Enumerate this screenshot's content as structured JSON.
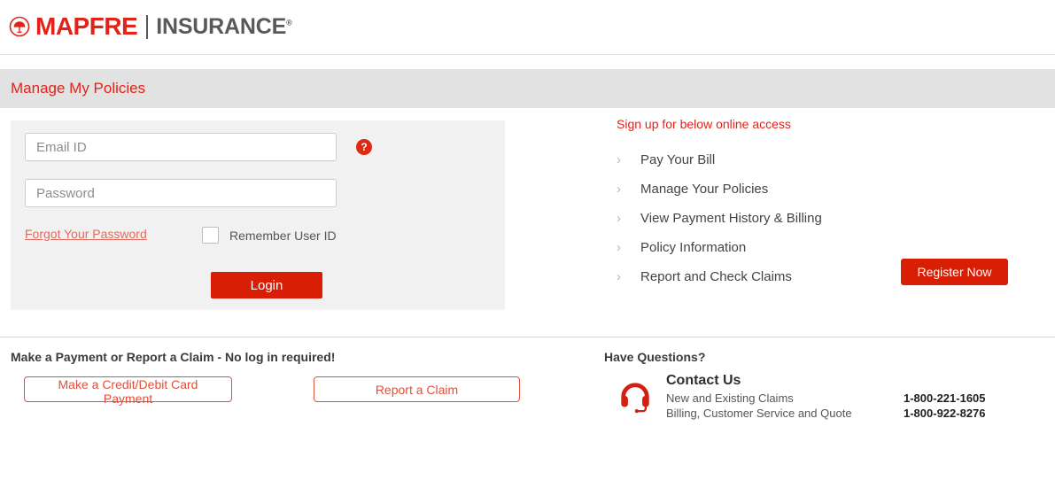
{
  "brand": {
    "mark_icon": "mapfre-logo-icon",
    "name": "MAPFRE",
    "sub": "INSURANCE",
    "registered_mark": "®"
  },
  "title_bar": {
    "text": "Manage My Policies"
  },
  "login": {
    "email_placeholder": "Email ID",
    "email_value": "",
    "password_placeholder": "Password",
    "password_value": "",
    "help_glyph": "?",
    "forgot_label": "Forgot Your Password",
    "remember_label": "Remember User ID",
    "remember_checked": false,
    "login_label": "Login"
  },
  "signup": {
    "heading": "Sign up for below online access",
    "chevron_glyph": "›",
    "items": [
      {
        "label": "Pay Your Bill"
      },
      {
        "label": "Manage Your Policies"
      },
      {
        "label": "View Payment History & Billing"
      },
      {
        "label": "Policy Information"
      },
      {
        "label": "Report and Check Claims"
      }
    ],
    "register_label": "Register Now"
  },
  "no_login": {
    "heading": "Make a Payment or Report a Claim - No log in required!",
    "pay_card_label": "Make a Credit/Debit Card Payment",
    "report_claim_label": "Report a Claim"
  },
  "contact": {
    "heading": "Have Questions?",
    "icon": "headset-icon",
    "title": "Contact Us",
    "lines": [
      {
        "desc": "New and Existing Claims",
        "phone": "1-800-221-1605"
      },
      {
        "desc": "Billing, Customer Service and Quote",
        "phone": "1-800-922-8276"
      }
    ]
  },
  "colors": {
    "brand_red": "#e2231a",
    "button_red": "#d81e05",
    "link_red": "#e26b5f",
    "outline_red": "#e2503a",
    "title_bar_gray": "#e2e2e2",
    "panel_gray": "#f1f1f1",
    "brand_dark_gray": "#58595b"
  }
}
